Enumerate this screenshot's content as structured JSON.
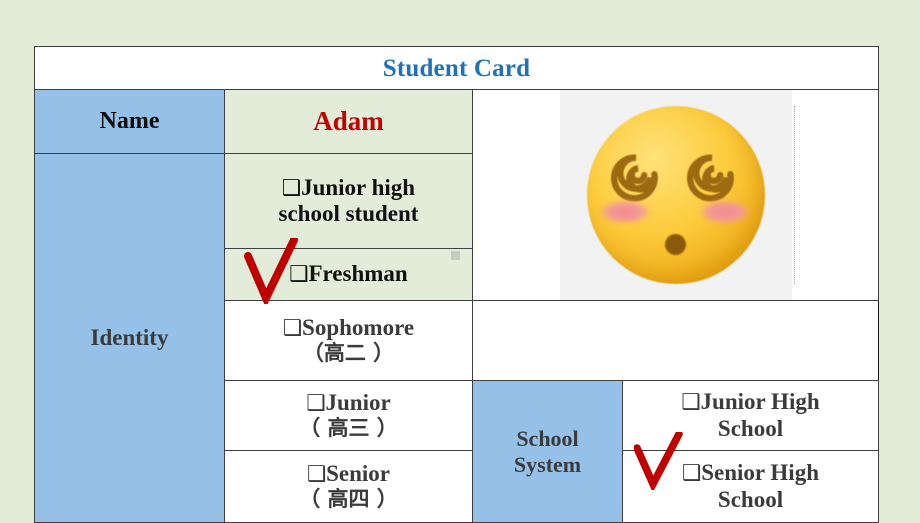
{
  "slide": {
    "background_color": "#e3ecd7",
    "accent_blue": "#95c1e8",
    "accent_green": "#e2ecd8",
    "title_color": "#1f72b8",
    "name_color": "#c00000",
    "check_color": "#c00000"
  },
  "card": {
    "title": "Student Card",
    "name_label": "Name",
    "name_value": "Adam",
    "identity_label": "Identity",
    "school_system_label": "School System",
    "school_system_label_line1": "School",
    "school_system_label_line2": "System",
    "checkbox_glyph": "❑",
    "check_glyph": "✓",
    "identity_options": [
      {
        "line1": "Junior high",
        "line2": "school student",
        "cjk": "",
        "checked": false,
        "fill": "#e2ecd8"
      },
      {
        "line1": "Freshman",
        "line2": "",
        "cjk": "",
        "checked": true,
        "fill": "#e2ecd8"
      },
      {
        "line1": "Sophomore",
        "line2": "",
        "cjk": "（高二 ）",
        "checked": false,
        "fill": "#ffffff"
      },
      {
        "line1": "Junior",
        "line2": "",
        "cjk": "（ 高三 ）",
        "checked": false,
        "fill": "#ffffff"
      },
      {
        "line1": "Senior",
        "line2": "",
        "cjk": "（ 高四 ）",
        "checked": false,
        "fill": "#ffffff"
      }
    ],
    "school_system_options": [
      {
        "line1": "Junior High",
        "line2": "School",
        "checked": false
      },
      {
        "line1": "Senior High",
        "line2": "School",
        "checked": true
      }
    ],
    "photo": {
      "icon_name": "dizzy-face-emoji",
      "description": "face with spiral eyes"
    }
  }
}
